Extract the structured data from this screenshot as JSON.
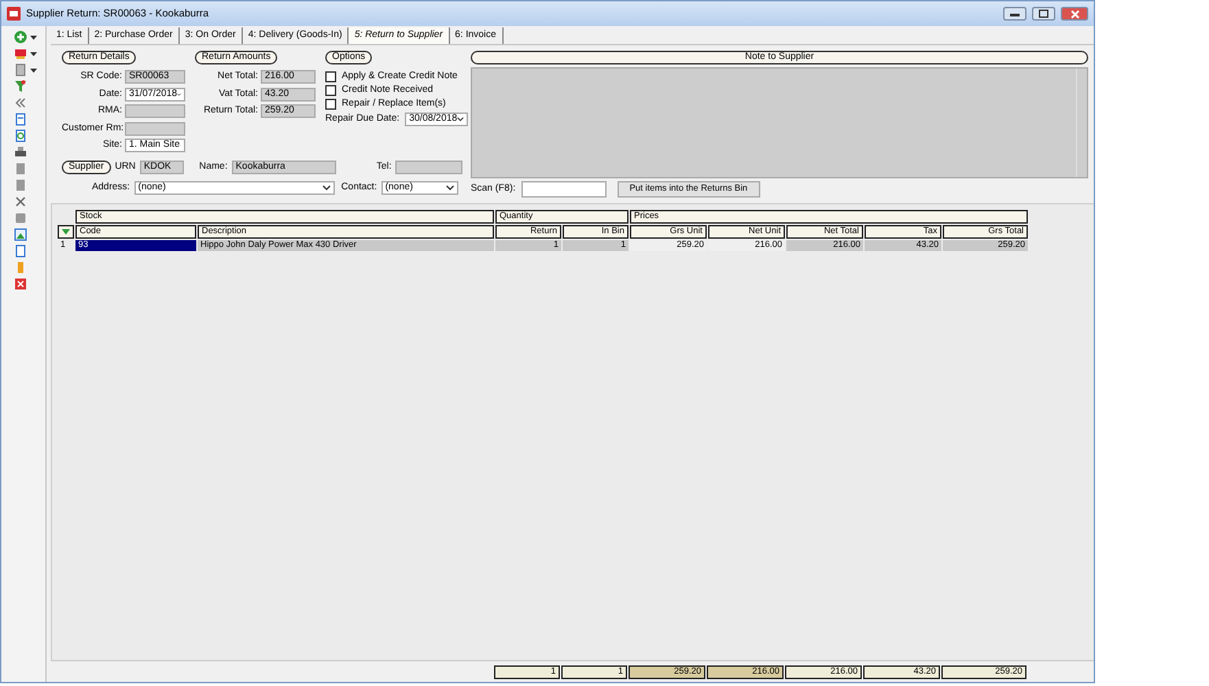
{
  "window": {
    "title": "Supplier Return: SR00063 - Kookaburra"
  },
  "tabs": [
    {
      "label": "1: List",
      "selected": false
    },
    {
      "label": "2: Purchase Order",
      "selected": false
    },
    {
      "label": "3: On Order",
      "selected": false
    },
    {
      "label": "4: Delivery (Goods-In)",
      "selected": false
    },
    {
      "label": "5: Return to Supplier",
      "selected": true
    },
    {
      "label": "6: Invoice",
      "selected": false
    }
  ],
  "return_details": {
    "heading": "Return Details",
    "fields": [
      {
        "label": "SR Code:",
        "value": "SR00063",
        "kind": "text"
      },
      {
        "label": "Date:",
        "value": "31/07/2018",
        "kind": "dropdown"
      },
      {
        "label": "RMA:",
        "kind": "text"
      },
      {
        "label": "Customer Rm:",
        "kind": "text"
      },
      {
        "label": "Site:",
        "value": "1. Main Site",
        "kind": "dropdown"
      }
    ]
  },
  "return_amounts": {
    "heading": "Return Amounts",
    "fields": [
      {
        "label": "Net Total:",
        "value": "216.00",
        "kind": "text"
      },
      {
        "label": "Vat Total:",
        "value": "43.20",
        "kind": "text"
      },
      {
        "label": "Return Total:",
        "value": "259.20",
        "kind": "text"
      }
    ]
  },
  "options": {
    "heading": "Options",
    "checkboxes": [
      {
        "label": "Apply & Create Credit Note",
        "checked": false
      },
      {
        "label": "Credit Note Received",
        "checked": false
      },
      {
        "label": "Repair / Replace Item(s)",
        "checked": false
      }
    ],
    "repair_due_date": {
      "label": "Repair Due Date:",
      "value": "30/08/2018"
    }
  },
  "supplier": {
    "heading": "Supplier",
    "urn": {
      "label": "URN",
      "value": "KDOK"
    },
    "name": {
      "label": "Name:",
      "value": "Kookaburra"
    },
    "tel": {
      "label": "Tel:"
    },
    "address": {
      "label": "Address:",
      "value": "(none)"
    },
    "contact": {
      "label": "Contact:",
      "value": "(none)"
    }
  },
  "note": {
    "heading": "Note to Supplier"
  },
  "scan": {
    "label": "Scan (F8):",
    "button": "Put items into the Returns Bin"
  },
  "table": {
    "groups": [
      {
        "label": "Stock",
        "columns": [
          {
            "label": "Code",
            "kind": "text",
            "editable": false
          },
          {
            "label": "Description",
            "kind": "text",
            "editable": false
          }
        ]
      },
      {
        "label": "Quantity",
        "columns": [
          {
            "label": "Return",
            "kind": "number",
            "editable": false
          },
          {
            "label": "In Bin",
            "kind": "number",
            "editable": false
          }
        ]
      },
      {
        "label": "Prices",
        "columns": [
          {
            "label": "Grs Unit",
            "kind": "number",
            "editable": true
          },
          {
            "label": "Net Unit",
            "kind": "number",
            "editable": true
          },
          {
            "label": "Net Total",
            "kind": "number",
            "editable": false
          },
          {
            "label": "Tax",
            "kind": "number",
            "editable": false
          },
          {
            "label": "Grs Total",
            "kind": "number",
            "editable": false
          }
        ]
      }
    ],
    "rows": [
      {
        "number": "1",
        "selected": true,
        "cells": [
          "93",
          "Hippo John Daly Power Max 430 Driver",
          "1",
          "1",
          "259.20",
          "216.00",
          "216.00",
          "43.20",
          "259.20"
        ]
      }
    ],
    "totals": [
      "1",
      "1",
      "259.20",
      "216.00",
      "216.00",
      "43.20",
      "259.20"
    ]
  }
}
